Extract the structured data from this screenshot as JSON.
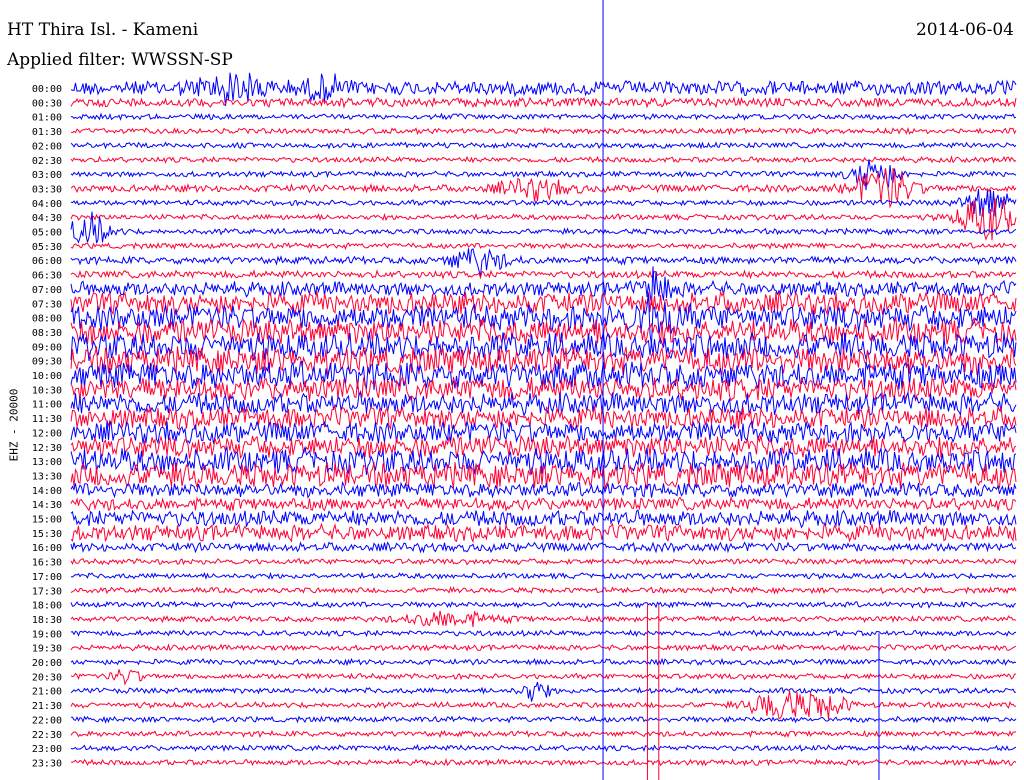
{
  "header": {
    "station": "HT Thira Isl. - Kameni",
    "date": "2014-06-04",
    "filter": "Applied filter: WWSSN-SP"
  },
  "chart_data": {
    "type": "line",
    "title": "HT Thira Isl. - Kameni",
    "ylabel": "EHZ - 20000",
    "time_labels": [
      "00:00",
      "00:30",
      "01:00",
      "01:30",
      "02:00",
      "02:30",
      "03:00",
      "03:30",
      "04:00",
      "04:30",
      "05:00",
      "05:30",
      "06:00",
      "06:30",
      "07:00",
      "07:30",
      "08:00",
      "08:30",
      "09:00",
      "09:30",
      "10:00",
      "10:30",
      "11:00",
      "11:30",
      "12:00",
      "12:30",
      "13:00",
      "13:30",
      "14:00",
      "14:30",
      "15:00",
      "15:30",
      "16:00",
      "16:30",
      "17:00",
      "17:30",
      "18:00",
      "18:30",
      "19:00",
      "19:30",
      "20:00",
      "20:30",
      "21:00",
      "21:30",
      "22:00",
      "22:30",
      "23:00",
      "23:30"
    ],
    "series_colors": [
      "#0000ff",
      "#ff0033"
    ],
    "noise_level": [
      8,
      5,
      3,
      3,
      3,
      3,
      3,
      4,
      3,
      3,
      3,
      3,
      4,
      4,
      8,
      12,
      14,
      14,
      15,
      15,
      15,
      13,
      12,
      12,
      12,
      12,
      14,
      14,
      8,
      7,
      9,
      9,
      5,
      3,
      3,
      3,
      3,
      3,
      3,
      3,
      3,
      3,
      3,
      3,
      3,
      3,
      3,
      3
    ],
    "events": [
      {
        "row": 0,
        "x": 0.17,
        "amp": 14,
        "width": 0.05
      },
      {
        "row": 0,
        "x": 0.27,
        "amp": 10,
        "width": 0.03
      },
      {
        "row": 7,
        "x": 0.49,
        "amp": 10,
        "width": 0.05
      },
      {
        "row": 6,
        "x": 0.85,
        "amp": 22,
        "width": 0.03
      },
      {
        "row": 7,
        "x": 0.86,
        "amp": 24,
        "width": 0.04
      },
      {
        "row": 8,
        "x": 0.97,
        "amp": 20,
        "width": 0.03
      },
      {
        "row": 9,
        "x": 0.97,
        "amp": 26,
        "width": 0.04
      },
      {
        "row": 10,
        "x": 0.02,
        "amp": 18,
        "width": 0.03
      },
      {
        "row": 12,
        "x": 0.43,
        "amp": 14,
        "width": 0.04
      },
      {
        "row": 14,
        "x": 0.62,
        "amp": 20,
        "width": 0.02
      },
      {
        "row": 16,
        "x": 0.62,
        "amp": 22,
        "width": 0.03
      },
      {
        "row": 37,
        "x": 0.4,
        "amp": 9,
        "width": 0.06
      },
      {
        "row": 41,
        "x": 0.06,
        "amp": 8,
        "width": 0.02
      },
      {
        "row": 42,
        "x": 0.49,
        "amp": 12,
        "width": 0.02
      },
      {
        "row": 43,
        "x": 0.75,
        "amp": 18,
        "width": 0.04
      },
      {
        "row": 43,
        "x": 0.8,
        "amp": 14,
        "width": 0.03
      }
    ],
    "vertical_markers": [
      {
        "x": 0.563,
        "color": "#0000ff",
        "from_row": 0,
        "to_row": 47
      },
      {
        "x": 0.61,
        "color": "#ff0033",
        "from_row": 36,
        "to_row": 47
      },
      {
        "x": 0.622,
        "color": "#ff0033",
        "from_row": 36,
        "to_row": 47
      },
      {
        "x": 0.855,
        "color": "#0000ff",
        "from_row": 38,
        "to_row": 45
      }
    ]
  }
}
